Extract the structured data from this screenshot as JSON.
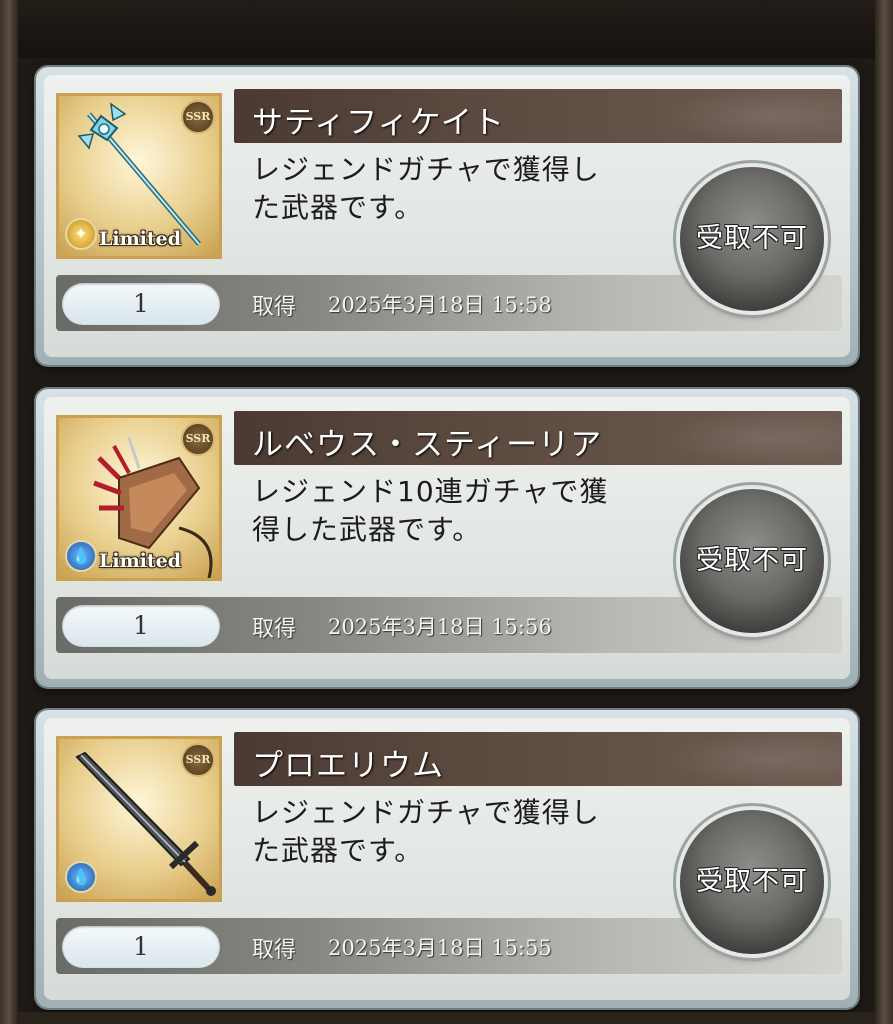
{
  "items": [
    {
      "name": "サティフィケイト",
      "description_line1": "レジェンドガチャで獲得し",
      "description_line2": "た武器です。",
      "rarity": "SSR",
      "element": "light",
      "limited_label": "Limited",
      "quantity": "1",
      "acquired_label": "取得",
      "acquired_time": "2025年3月18日 15:58",
      "button_label": "受取不可"
    },
    {
      "name": "ルベウス・スティーリア",
      "description_line1": "レジェンド10連ガチャで獲",
      "description_line2": "得した武器です。",
      "rarity": "SSR",
      "element": "water",
      "limited_label": "Limited",
      "quantity": "1",
      "acquired_label": "取得",
      "acquired_time": "2025年3月18日 15:56",
      "button_label": "受取不可"
    },
    {
      "name": "プロエリウム",
      "description_line1": "レジェンドガチャで獲得し",
      "description_line2": "た武器です。",
      "rarity": "SSR",
      "element": "water",
      "quantity": "1",
      "acquired_label": "取得",
      "acquired_time": "2025年3月18日 15:55",
      "button_label": "受取不可"
    }
  ],
  "colors": {
    "title_bar": "#4a3a32",
    "thumb_border": "#caa052",
    "button_gray": "#6a6a67"
  }
}
